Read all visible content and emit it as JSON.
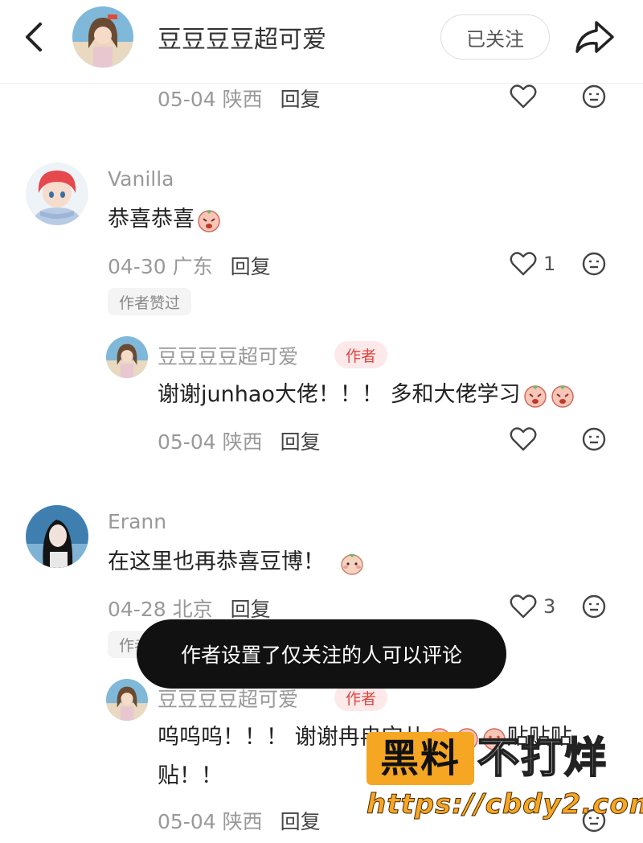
{
  "header": {
    "title": "豆豆豆豆超可爱",
    "follow_label": "已关注"
  },
  "comments": [
    {
      "meta_date": "05-04 陕西",
      "reply_label": "回复"
    },
    {
      "username": "Vanilla",
      "content": "恭喜恭喜",
      "meta_date": "04-30 广东",
      "reply_label": "回复",
      "like_count": "1",
      "tag": "作者赞过",
      "reply": {
        "username": "豆豆豆豆超可爱",
        "badge": "作者",
        "content": "谢谢junhao大佬！！！ 多和大佬学习",
        "meta_date": "05-04 陕西",
        "reply_label": "回复"
      }
    },
    {
      "username": "Erann",
      "content": "在这里也再恭喜豆博！",
      "meta_date": "04-28 北京",
      "reply_label": "回复",
      "like_count": "3",
      "tag": "作者",
      "reply": {
        "username": "豆豆豆豆超可爱",
        "badge": "作者",
        "content_line1": "呜呜呜！！！ 谢谢冉冉宝儿",
        "content_sticker_text": "贴贴贴",
        "content_line2": "贴！！",
        "meta_date": "05-04 陕西",
        "reply_label": "回复"
      }
    }
  ],
  "toast": "作者设置了仅关注的人可以评论",
  "watermark": {
    "box_text": "黑料",
    "text": "不打烊",
    "url": "https://cbdy2.com"
  },
  "colors": {
    "accent_red": "#e0453f",
    "watermark_orange": "#f5a623",
    "toast_bg": "#111111"
  }
}
